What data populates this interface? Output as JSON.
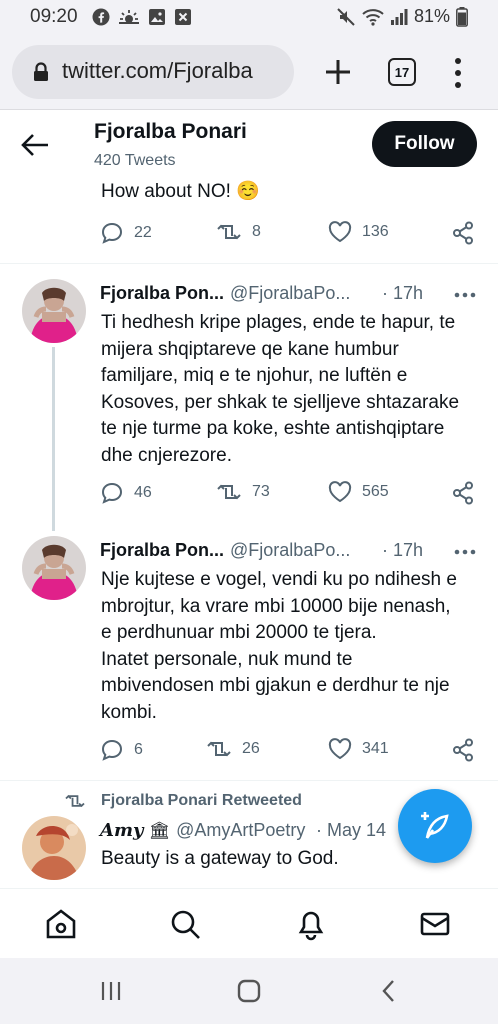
{
  "status_bar": {
    "time": "09:20",
    "battery": "81%"
  },
  "browser": {
    "url": "twitter.com/Fjoralba",
    "tab_count": "17"
  },
  "profile": {
    "name": "Fjoralba Ponari",
    "tweet_count": "420 Tweets",
    "follow_label": "Follow"
  },
  "tweets": [
    {
      "text": "How about NO! ☺️",
      "replies": "22",
      "retweets": "8",
      "likes": "136"
    },
    {
      "name": "Fjoralba Pon...",
      "handle": "@FjoralbaPo...",
      "time": "· 17h",
      "lines": [
        "Ti hedhesh kripe plages, ende te hapur, te",
        "mijera shqiptareve qe kane humbur",
        "familjare, miq e te njohur, ne luftën e",
        "Kosoves, per shkak te sjelljeve shtazarake",
        "te nje turme pa koke, eshte antishqiptare",
        "dhe cnjerezore."
      ],
      "replies": "46",
      "retweets": "73",
      "likes": "565"
    },
    {
      "name": "Fjoralba Pon...",
      "handle": "@FjoralbaPo...",
      "time": "· 17h",
      "lines": [
        "Nje kujtese e vogel, vendi ku po ndihesh e",
        "mbrojtur, ka vrare mbi 10000 bije nenash,",
        "e perdhunuar mbi 20000 te tjera.",
        "Inatet personale, nuk mund te",
        "mbivendosen mbi gjakun e derdhur te nje",
        "kombi."
      ],
      "replies": "6",
      "retweets": "26",
      "likes": "341"
    },
    {
      "retweeted_by": "Fjoralba Ponari Retweeted",
      "name": "Amy",
      "handle": "@AmyArtPoetry",
      "time": "· May 14",
      "text": "Beauty is a gateway to God."
    }
  ],
  "icons": {
    "reply": "reply-icon",
    "retweet": "retweet-icon",
    "like": "heart-icon",
    "share": "share-icon",
    "compose": "compose-tweet-icon",
    "home": "home-icon",
    "search": "search-icon",
    "notifications": "bell-icon",
    "messages": "mail-icon"
  },
  "colors": {
    "accent": "#1d9bf0",
    "follow_bg": "#0f1419",
    "secondary_text": "#536471"
  }
}
